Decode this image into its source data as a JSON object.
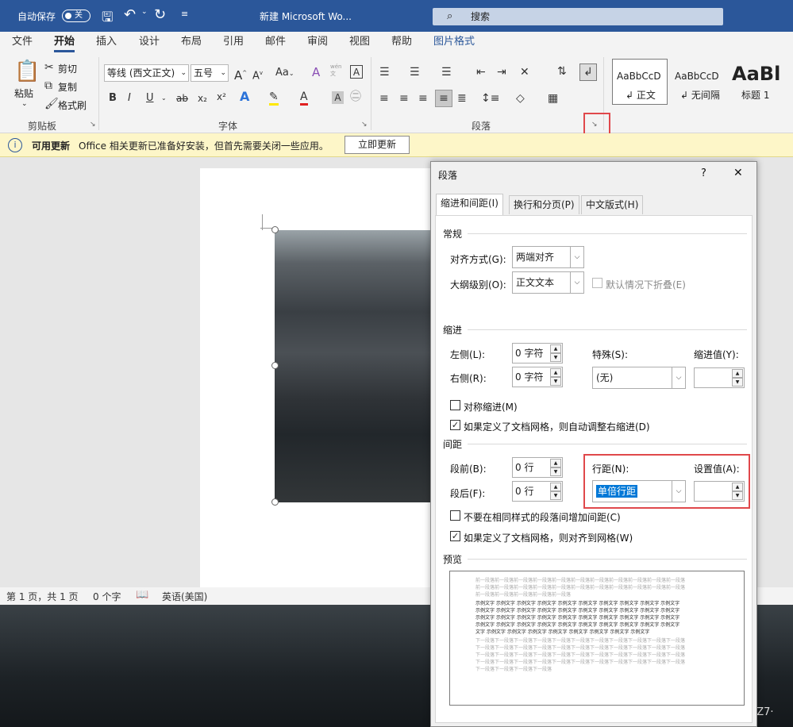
{
  "titlebar": {
    "autosave_label": "自动保存",
    "autosave_state": "关",
    "doc_title": "新建 Microsoft Wo...",
    "search_placeholder": "搜索"
  },
  "tabs": [
    "文件",
    "开始",
    "插入",
    "设计",
    "布局",
    "引用",
    "邮件",
    "审阅",
    "视图",
    "帮助",
    "图片格式"
  ],
  "ribbon": {
    "clipboard": {
      "paste": "粘贴",
      "cut": "剪切",
      "copy": "复制",
      "format_painter": "格式刷",
      "group": "剪贴板"
    },
    "font": {
      "font_name": "等线 (西文正文)",
      "font_size": "五号",
      "bold": "B",
      "italic": "I",
      "underline": "U",
      "strike": "ab",
      "sub": "x₂",
      "sup": "x²",
      "group": "字体",
      "wen": "wén\n文",
      "aa": "Aa"
    },
    "paragraph": {
      "group": "段落"
    },
    "styles": {
      "normal_preview": "AaBbCcD",
      "normal": "↲ 正文",
      "nospacing_preview": "AaBbCcD",
      "nospacing": "↲ 无间隔",
      "heading_preview": "AaBl",
      "heading": "标题 1"
    }
  },
  "infobar": {
    "title": "可用更新",
    "message": "Office 相关更新已准备好安装，但首先需要关闭一些应用。",
    "button": "立即更新"
  },
  "statusbar": {
    "page": "第 1 页，共 1 页",
    "words": "0 个字",
    "lang": "英语(美国)"
  },
  "dialog": {
    "title": "段落",
    "help": "?",
    "close": "✕",
    "tabs": [
      "缩进和间距(I)",
      "换行和分页(P)",
      "中文版式(H)"
    ],
    "general": {
      "section": "常规",
      "alignment_label": "对齐方式(G):",
      "alignment_value": "两端对齐",
      "outline_label": "大纲级别(O):",
      "outline_value": "正文文本",
      "collapse_label": "默认情况下折叠(E)"
    },
    "indent": {
      "section": "缩进",
      "left_label": "左侧(L):",
      "left_value": "0 字符",
      "right_label": "右侧(R):",
      "right_value": "0 字符",
      "special_label": "特殊(S):",
      "special_value": "(无)",
      "by_label": "缩进值(Y):",
      "by_value": "",
      "mirror_label": "对称缩进(M)",
      "auto_adjust_label": "如果定义了文档网格，则自动调整右缩进(D)"
    },
    "spacing": {
      "section": "间距",
      "before_label": "段前(B):",
      "before_value": "0 行",
      "after_label": "段后(F):",
      "after_value": "0 行",
      "line_label": "行距(N):",
      "line_value": "单倍行距",
      "at_label": "设置值(A):",
      "at_value": "",
      "no_space_label": "不要在相同样式的段落间增加间距(C)",
      "snap_grid_label": "如果定义了文档网格，则对齐到网格(W)"
    },
    "preview": {
      "section": "预览",
      "prev_lines": [
        "前一段落前一段落前一段落前一段落前一段落前一段落前一段落前一段落前一段落前一段落前一段落",
        "前一段落前一段落前一段落前一段落前一段落前一段落前一段落前一段落前一段落前一段落前一段落",
        "前一段落前一段落前一段落前一段落前一段落"
      ],
      "sample_lines": [
        "示例文字 示例文字 示例文字 示例文字 示例文字 示例文字 示例文字 示例文字 示例文字 示例文字",
        "示例文字 示例文字 示例文字 示例文字 示例文字 示例文字 示例文字 示例文字 示例文字 示例文字",
        "示例文字 示例文字 示例文字 示例文字 示例文字 示例文字 示例文字 示例文字 示例文字 示例文字",
        "示例文字 示例文字 示例文字 示例文字 示例文字 示例文字 示例文字 示例文字 示例文字 示例文字",
        "文字 示例文字 示例文字 示例文字 示例文字 示例文字 示例文字 示例文字 示例文字"
      ],
      "next_lines": [
        "下一段落下一段落下一段落下一段落下一段落下一段落下一段落下一段落下一段落下一段落下一段落",
        "下一段落下一段落下一段落下一段落下一段落下一段落下一段落下一段落下一段落下一段落下一段落",
        "下一段落下一段落下一段落下一段落下一段落下一段落下一段落下一段落下一段落下一段落下一段落",
        "下一段落下一段落下一段落下一段落下一段落下一段落下一段落下一段落下一段落下一段落下一段落",
        "下一段落下一段落下一段落下一段落"
      ]
    }
  },
  "watermark": "CSDN @Z7·",
  "colors": {
    "brand": "#2b579a",
    "highlight": "#e0484b",
    "selection": "#0078d7"
  }
}
